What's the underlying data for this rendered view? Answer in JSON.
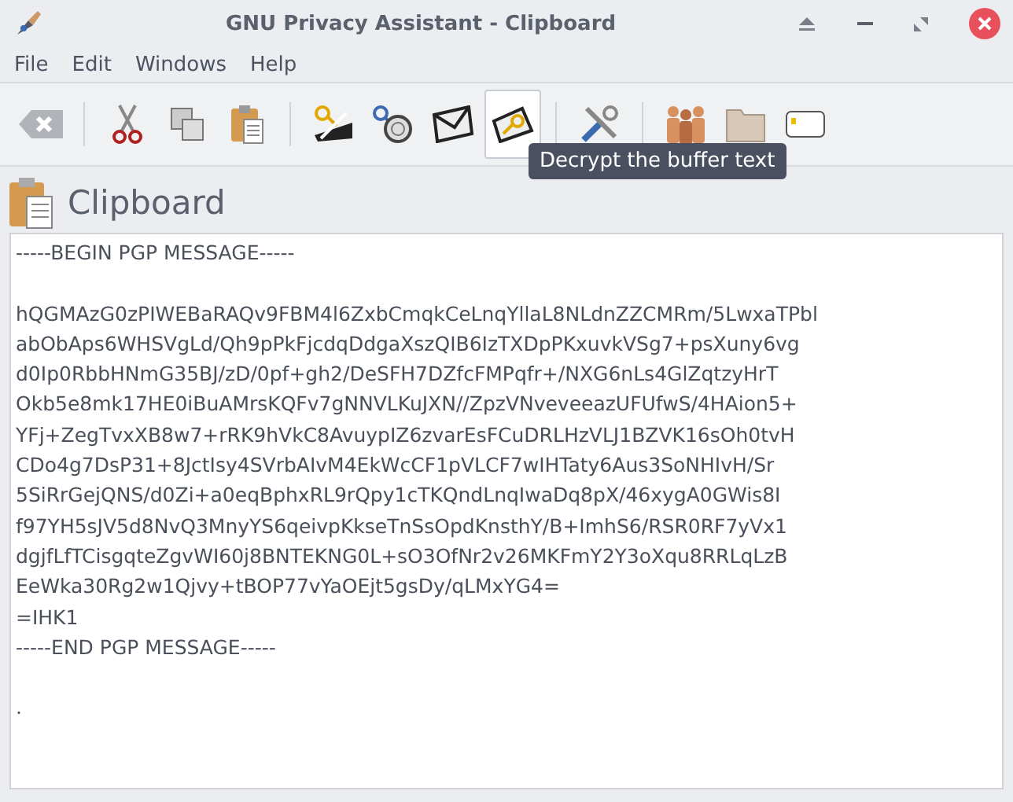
{
  "window": {
    "title": "GNU Privacy Assistant - Clipboard"
  },
  "menu": [
    "File",
    "Edit",
    "Windows",
    "Help"
  ],
  "toolbar": {
    "groups": [
      [
        {
          "hovered": false
        }
      ],
      [
        {
          "hovered": false
        },
        {
          "hovered": false
        },
        {
          "hovered": false
        }
      ],
      [
        {
          "hovered": false
        },
        {
          "hovered": false
        },
        {
          "hovered": false
        },
        {
          "hovered": true
        }
      ],
      [
        {
          "hovered": false
        }
      ],
      [
        {
          "hovered": false
        },
        {
          "hovered": false
        },
        {
          "hovered": false
        }
      ]
    ],
    "tooltip": "Decrypt the buffer text"
  },
  "heading": "Clipboard",
  "text_blocks": [
    [
      "-----BEGIN PGP MESSAGE-----"
    ],
    [
      "hQGMAzG0zPIWEBaRAQv9FBM4l6ZxbCmqkCeLnqYllaL8NLdnZZCMRm/5LwxaTPbl",
      "abObAps6WHSVgLd/Qh9pPkFjcdqDdgaXszQIB6IzTXDpPKxuvkVSg7+psXuny6vg",
      "d0Ip0RbbHNmG35BJ/zD/0pf+gh2/DeSFH7DZfcFMPqfr+/NXG6nLs4GlZqtzyHrT",
      "Okb5e8mk17HE0iBuAMrsKQFv7gNNVLKuJXN//ZpzVNveveeazUFUfwS/4HAion5+",
      "YFj+ZegTvxXB8w7+rRK9hVkC8AvuypIZ6zvarEsFCuDRLHzVLJ1BZVK16sOh0tvH",
      "CDo4g7DsP31+8JctIsy4SVrbAIvM4EkWcCF1pVLCF7wIHTaty6Aus3SoNHIvH/Sr",
      "5SiRrGejQNS/d0Zi+a0eqBphxRL9rQpy1cTKQndLnqIwaDq8pX/46xygA0GWis8I",
      "f97YH5sJV5d8NvQ3MnyYS6qeivpKkseTnSsOpdKnsthY/B+ImhS6/RSR0RF7yVx1",
      "dgjfLfTCisgqteZgvWI60j8BNTEKNG0L+sO3OfNr2v26MKFmY2Y3oXqu8RRLqLzB",
      "EeWka30Rg2w1Qjvy+tBOP77vYaOEjt5gsDy/qLMxYG4=",
      "=IHK1",
      "-----END PGP MESSAGE-----"
    ],
    [
      "."
    ]
  ]
}
